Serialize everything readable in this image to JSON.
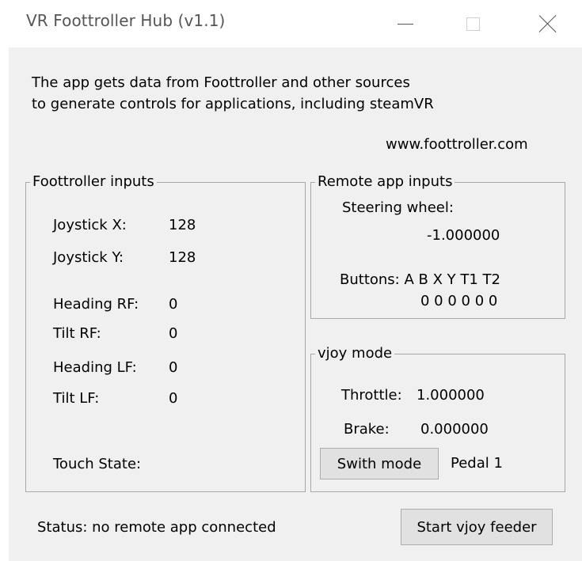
{
  "window": {
    "title": "VR Foottroller Hub (v1.1)"
  },
  "intro": {
    "line1": "The app gets data from Foottroller and other sources",
    "line2": "to generate controls for applications, including steamVR",
    "website": "www.foottroller.com"
  },
  "foottroller_inputs": {
    "title": "Foottroller inputs",
    "joystick_x_label": "Joystick X:",
    "joystick_x_value": "128",
    "joystick_y_label": "Joystick Y:",
    "joystick_y_value": "128",
    "heading_rf_label": "Heading RF:",
    "heading_rf_value": "0",
    "tilt_rf_label": "Tilt RF:",
    "tilt_rf_value": "0",
    "heading_lf_label": "Heading LF:",
    "heading_lf_value": "0",
    "tilt_lf_label": "Tilt LF:",
    "tilt_lf_value": "0",
    "touch_state_label": "Touch State:"
  },
  "remote_inputs": {
    "title": "Remote app inputs",
    "steering_label": "Steering wheel:",
    "steering_value": "-1.000000",
    "buttons_label": "Buttons: A B X Y T1 T2",
    "buttons_values": "0 0 0 0 0 0"
  },
  "vjoy_mode": {
    "title": "vjoy mode",
    "throttle_label": "Throttle:",
    "throttle_value": "1.000000",
    "brake_label": "Brake:",
    "brake_value": "0.000000",
    "switch_button": "Swith mode",
    "mode_value": "Pedal 1"
  },
  "footer": {
    "status": "Status: no remote app connected",
    "start_button": "Start vjoy feeder"
  }
}
